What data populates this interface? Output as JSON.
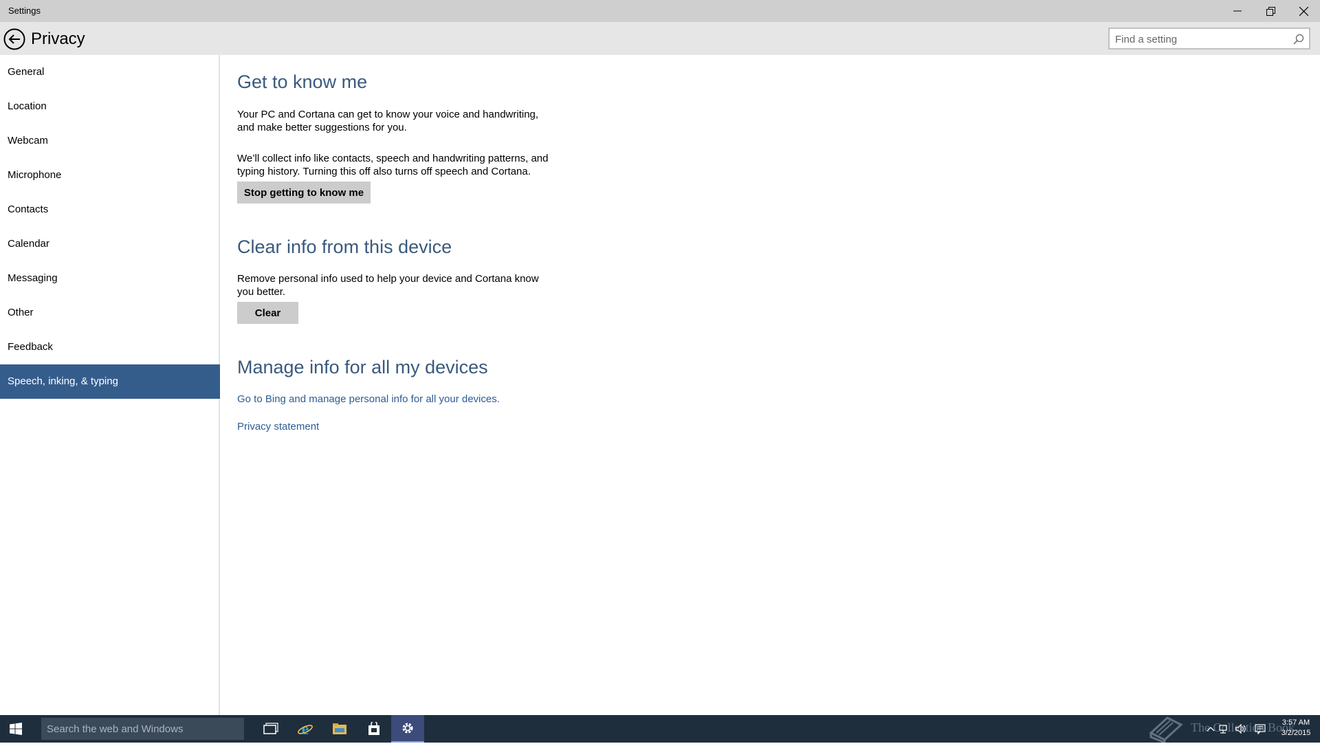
{
  "window": {
    "title": "Settings"
  },
  "header": {
    "page_title": "Privacy",
    "search_placeholder": "Find a setting"
  },
  "sidebar": {
    "items": [
      {
        "label": "General"
      },
      {
        "label": "Location"
      },
      {
        "label": "Webcam"
      },
      {
        "label": "Microphone"
      },
      {
        "label": "Contacts"
      },
      {
        "label": "Calendar"
      },
      {
        "label": "Messaging"
      },
      {
        "label": "Other"
      },
      {
        "label": "Feedback"
      },
      {
        "label": "Speech, inking, & typing"
      }
    ],
    "selected_index": 9
  },
  "main": {
    "get_to_know": {
      "title": "Get to know me",
      "para1": "Your PC and Cortana can get to know your voice and handwriting, and make better suggestions for you.",
      "para2": "We’ll collect info like contacts, speech and handwriting patterns, and typing history. Turning this off also turns off speech and Cortana.",
      "button": "Stop getting to know me"
    },
    "clear_info": {
      "title": "Clear info from this device",
      "para": "Remove personal info used to help your device and Cortana know you better.",
      "button": "Clear"
    },
    "manage_info": {
      "title": "Manage info for all my devices",
      "link": "Go to Bing and manage personal info for all your devices."
    },
    "privacy_link": "Privacy statement"
  },
  "taskbar": {
    "search_placeholder": "Search the web and Windows",
    "apps": [
      "task-view-icon",
      "internet-explorer-icon",
      "file-explorer-icon",
      "store-icon",
      "settings-icon"
    ],
    "watermark": "The Collection Book",
    "clock_time": "3:57 AM",
    "clock_date": "3/2/2015"
  },
  "colors": {
    "accent": "#355d8c",
    "heading": "#3a5a7d",
    "link": "#2b5d96",
    "taskbar": "#1f2e3d"
  }
}
